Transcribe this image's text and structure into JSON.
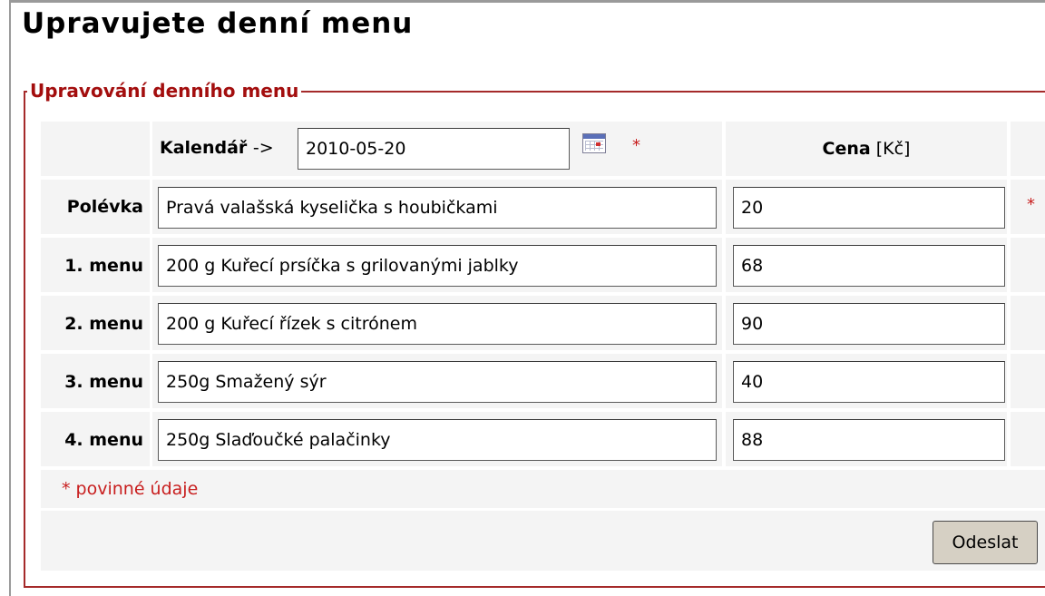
{
  "page_title": "Upravujete denní menu",
  "fieldset_legend": "Upravování denního menu",
  "calendar": {
    "label": "Kalendář",
    "arrow": "->",
    "date_value": "2010-05-20",
    "required_mark": "*"
  },
  "price_header": {
    "label": "Cena",
    "unit": "[Kč]"
  },
  "rows": [
    {
      "label": "Polévka",
      "dish": "Pravá valašská kyselička s houbičkami",
      "price": "20",
      "required_mark": "*"
    },
    {
      "label": "1. menu",
      "dish": "200 g Kuřecí prsíčka s grilovanými jablky",
      "price": "68"
    },
    {
      "label": "2. menu",
      "dish": "200 g Kuřecí řízek s citrónem",
      "price": "90"
    },
    {
      "label": "3. menu",
      "dish": "250g Smažený sýr",
      "price": "40"
    },
    {
      "label": "4. menu",
      "dish": "250g Slaďoučké palačinky",
      "price": "88"
    }
  ],
  "required_note": "* povinné údaje",
  "submit_label": "Odeslat",
  "colors": {
    "legend": "#a30e0e",
    "required": "#c81e1e",
    "cell_bg": "#f4f4f4",
    "button_bg": "#d6d0c4"
  }
}
